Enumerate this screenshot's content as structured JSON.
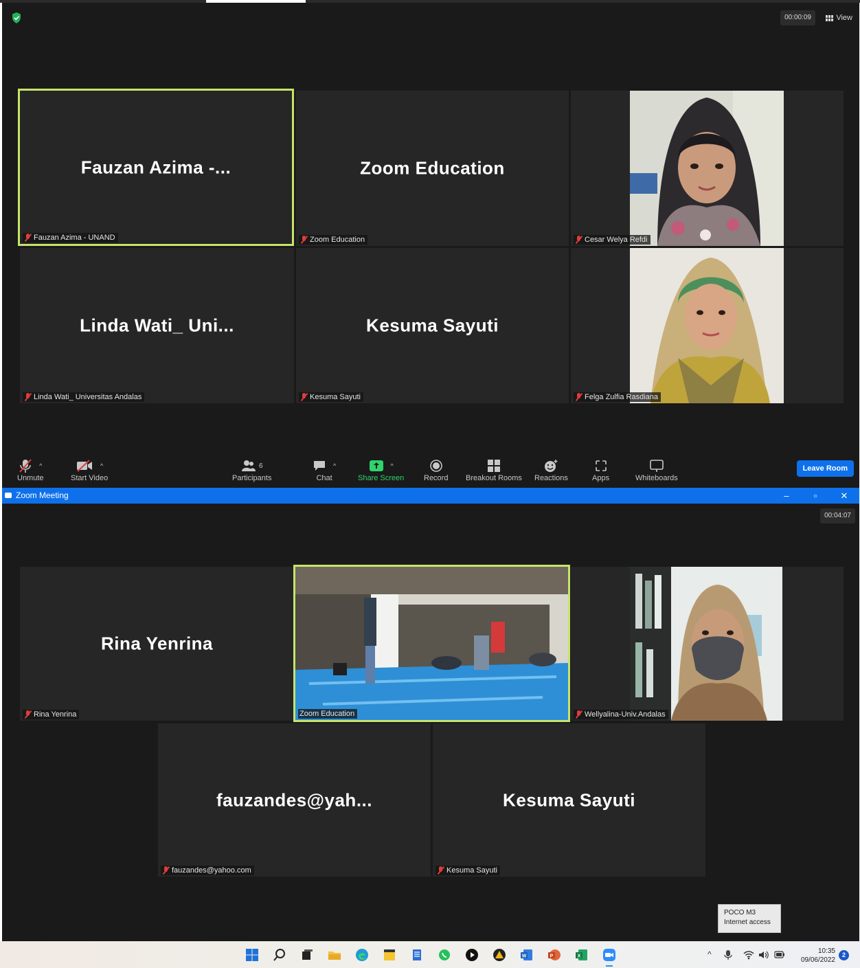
{
  "window1": {
    "timer": "00:00:09",
    "view_label": "View",
    "tiles": [
      {
        "bigname": "Fauzan Azima -...",
        "label": "Fauzan Azima - UNAND"
      },
      {
        "bigname": "Zoom Education",
        "label": "Zoom Education"
      },
      {
        "label": "Cesar Welya Refdi"
      },
      {
        "bigname": "Linda Wati_ Uni...",
        "label": "Linda Wati_ Universitas Andalas"
      },
      {
        "bigname": "Kesuma Sayuti",
        "label": "Kesuma Sayuti"
      },
      {
        "label": "Felga Zulfia Rasdiana"
      }
    ],
    "toolbar": {
      "unmute": "Unmute",
      "start_video": "Start Video",
      "participants": "Participants",
      "participants_count": "6",
      "chat": "Chat",
      "share_screen": "Share Screen",
      "record": "Record",
      "breakout_rooms": "Breakout Rooms",
      "reactions": "Reactions",
      "apps": "Apps",
      "whiteboards": "Whiteboards",
      "leave": "Leave Room"
    }
  },
  "window2": {
    "title": "Zoom Meeting",
    "timer": "00:04:07",
    "tiles": [
      {
        "bigname": "Rina Yenrina",
        "label": "Rina Yenrina"
      },
      {
        "label": "Zoom Education"
      },
      {
        "label": "Wellyalina-Univ.Andalas"
      },
      {
        "bigname": "fauzandes@yah...",
        "label": "fauzandes@yahoo.com"
      },
      {
        "bigname": "Kesuma Sayuti",
        "label": "Kesuma Sayuti"
      }
    ]
  },
  "tooltip": {
    "line1": "POCO M3",
    "line2": "Internet access"
  },
  "taskbar": {
    "time": "10:35",
    "date": "09/06/2022",
    "notification_count": "2"
  },
  "colors": {
    "meeting_bg": "#1a1a1a",
    "tile_bg": "#262626",
    "active_speaker": "#c6e46a",
    "zoom_blue": "#0e71eb",
    "muted_red": "#e03c3c",
    "share_green": "#2fd36c"
  }
}
